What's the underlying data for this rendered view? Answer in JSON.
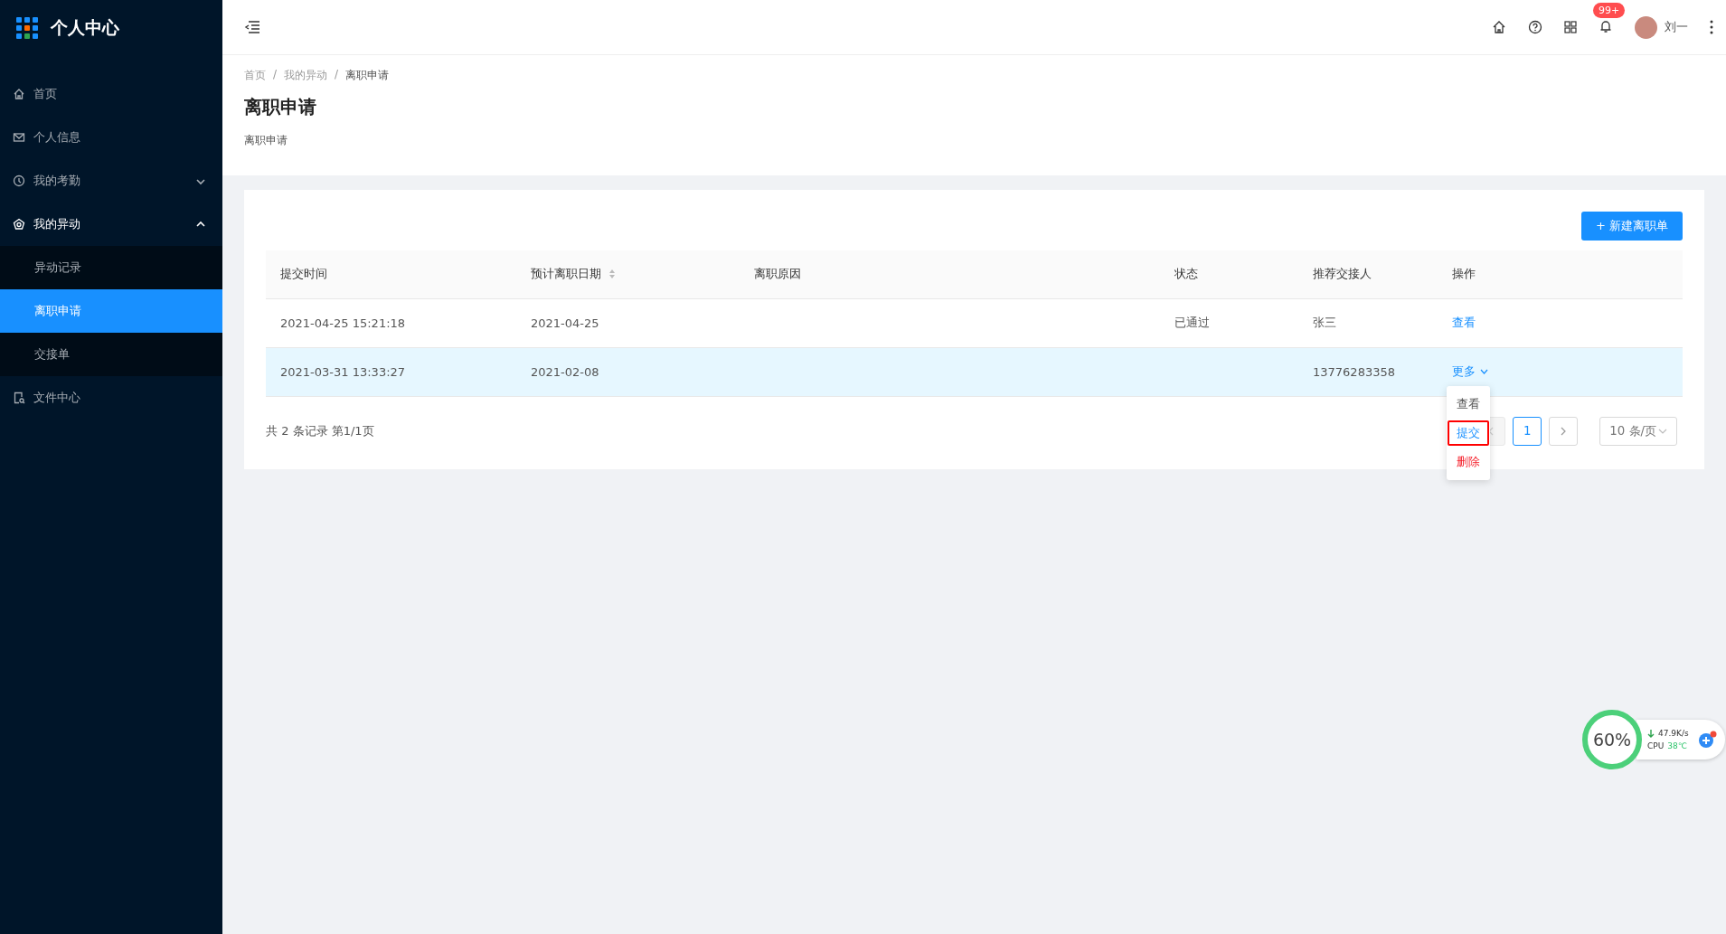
{
  "sidebar": {
    "title": "个人中心",
    "items": [
      {
        "label": "首页",
        "selected": false
      },
      {
        "label": "个人信息",
        "selected": false
      },
      {
        "label": "我的考勤",
        "selected": false,
        "expanded": false,
        "kind": "group"
      },
      {
        "label": "我的异动",
        "selected": false,
        "expanded": true,
        "kind": "group",
        "children": [
          {
            "label": "异动记录",
            "selected": false
          },
          {
            "label": "离职申请",
            "selected": true
          },
          {
            "label": "交接单",
            "selected": false
          }
        ]
      },
      {
        "label": "文件中心",
        "selected": false
      }
    ]
  },
  "header": {
    "badge": "99+",
    "user": "刘一"
  },
  "breadcrumb": {
    "separator": "/",
    "items": [
      "首页",
      "我的异动",
      "离职申请"
    ]
  },
  "page_title": "离职申请",
  "page_subtitle": "离职申请",
  "new_button": "+ 新建离职单",
  "table": {
    "columns": [
      {
        "label": "提交时间",
        "sortable": false
      },
      {
        "label": "预计离职日期",
        "sortable": true
      },
      {
        "label": "离职原因",
        "sortable": false
      },
      {
        "label": "状态",
        "sortable": false
      },
      {
        "label": "推荐交接人",
        "sortable": false
      },
      {
        "label": "操作",
        "sortable": false
      }
    ],
    "rows": [
      {
        "cells": [
          "2021-04-25 15:21:18",
          "2021-04-25",
          "",
          "已通过",
          "张三"
        ],
        "action": "查看",
        "kind": "link",
        "hovered": false
      },
      {
        "cells": [
          "2021-03-31 13:33:27",
          "2021-02-08",
          "",
          "",
          "13776283358"
        ],
        "action": "更多",
        "kind": "dropdown",
        "hovered": true
      }
    ]
  },
  "dropdown": [
    {
      "label": "查看",
      "kind": "normal",
      "highlighted": false
    },
    {
      "label": "提交",
      "kind": "primary",
      "highlighted": true
    },
    {
      "label": "删除",
      "kind": "danger",
      "highlighted": false
    }
  ],
  "summary": "共 2 条记录 第1/1页",
  "pagination": {
    "prev_disabled": true,
    "pages": [
      {
        "label": "1",
        "selected": true
      }
    ],
    "page_size": "10 条/页"
  },
  "widget": {
    "percent": "60%",
    "speed": "47.9K/s",
    "cpu_label": "CPU",
    "temp": "38℃"
  }
}
